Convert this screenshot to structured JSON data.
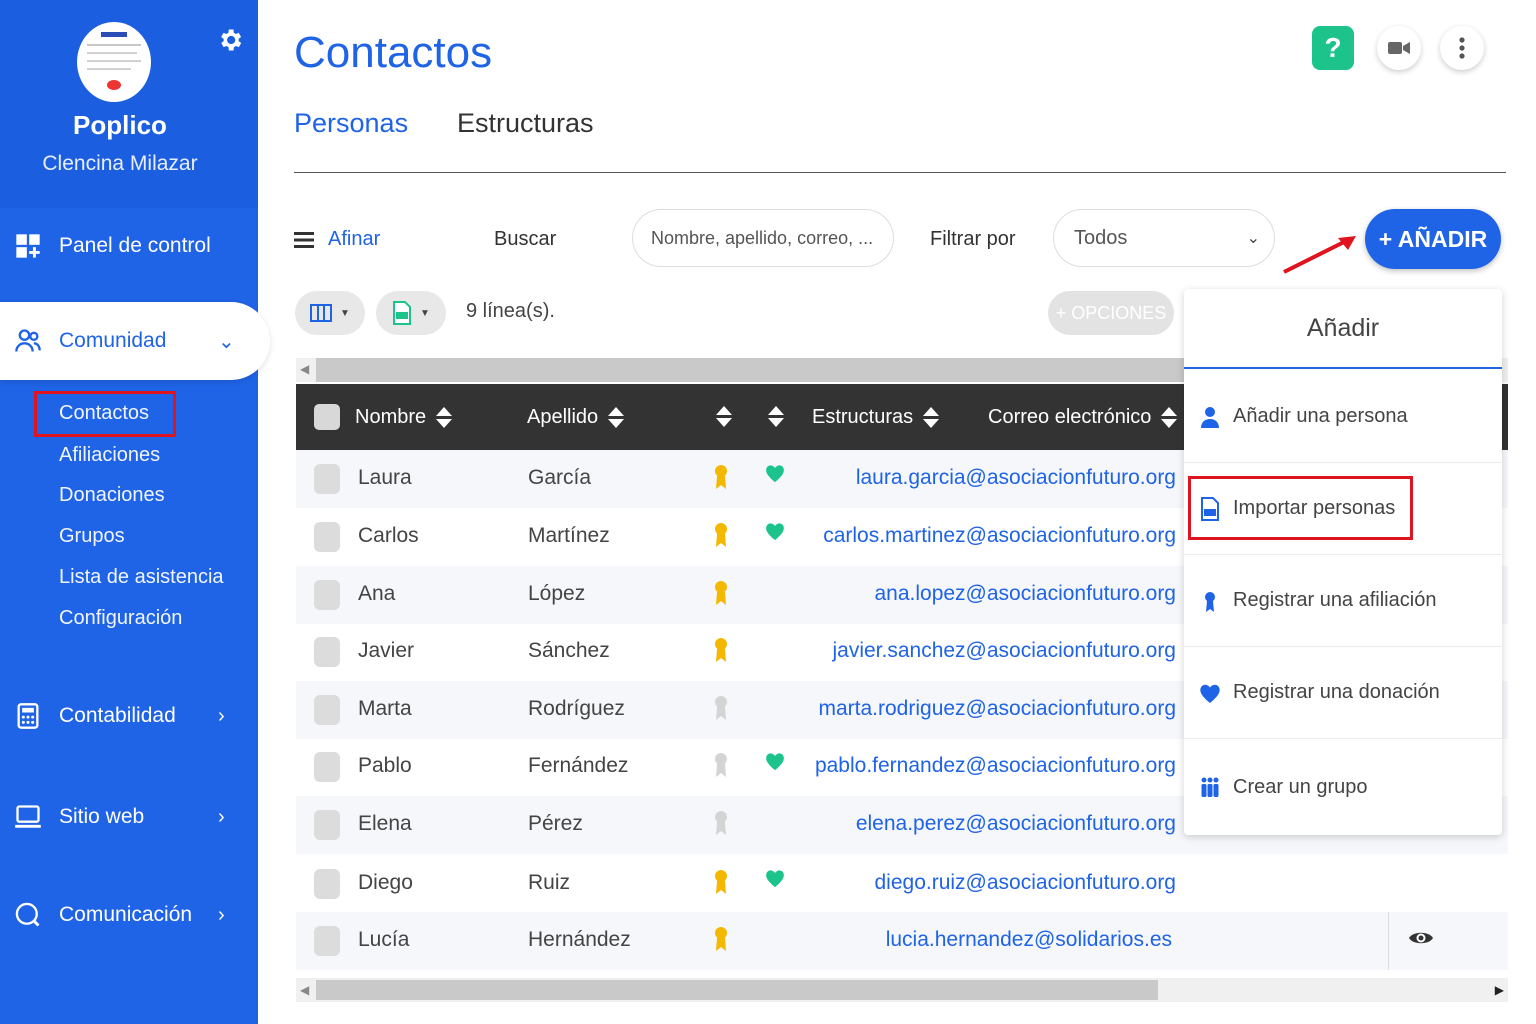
{
  "org": {
    "name": "Poplico",
    "user": "Clencina Milazar"
  },
  "sidebar": {
    "items": [
      {
        "label": "Panel de control",
        "icon": "dashboard-icon"
      },
      {
        "label": "Comunidad",
        "icon": "community-icon",
        "chevron": "⌄"
      },
      {
        "label": "Contabilidad",
        "icon": "calculator-icon",
        "chevron": "›"
      },
      {
        "label": "Sitio web",
        "icon": "monitor-icon",
        "chevron": "›"
      },
      {
        "label": "Comunicación",
        "icon": "chat-icon",
        "chevron": "›"
      }
    ],
    "sub_items": [
      "Contactos",
      "Afiliaciones",
      "Donaciones",
      "Grupos",
      "Lista de asistencia",
      "Configuración"
    ]
  },
  "header": {
    "title": "Contactos",
    "help": "?"
  },
  "tabs": [
    "Personas",
    "Estructuras"
  ],
  "toolbar": {
    "afinar": "Afinar",
    "buscar_label": "Buscar",
    "search_placeholder": "Nombre, apellido, correo, ...",
    "filtrar_label": "Filtrar por",
    "filter_value": "Todos",
    "add_button": "+ AÑADIR",
    "rows_count": "9 línea(s).",
    "options_button": "+ OPCIONES"
  },
  "table": {
    "headers": {
      "first": "Nombre",
      "last": "Apellido",
      "structures": "Estructuras",
      "email": "Correo electrónico"
    },
    "rows": [
      {
        "first": "Laura",
        "last": "García",
        "medal": "gold",
        "heart": true,
        "email": "laura.garcia@asociacionfuturo.org"
      },
      {
        "first": "Carlos",
        "last": "Martínez",
        "medal": "gold",
        "heart": true,
        "email": "carlos.martinez@asociacionfuturo.org"
      },
      {
        "first": "Ana",
        "last": "López",
        "medal": "gold",
        "heart": false,
        "email": "ana.lopez@asociacionfuturo.org"
      },
      {
        "first": "Javier",
        "last": "Sánchez",
        "medal": "gold",
        "heart": false,
        "email": "javier.sanchez@asociacionfuturo.org"
      },
      {
        "first": "Marta",
        "last": "Rodríguez",
        "medal": "gray",
        "heart": false,
        "email": "marta.rodriguez@asociacionfuturo.org"
      },
      {
        "first": "Pablo",
        "last": "Fernández",
        "medal": "gray",
        "heart": true,
        "email": "pablo.fernandez@asociacionfuturo.org"
      },
      {
        "first": "Elena",
        "last": "Pérez",
        "medal": "gray",
        "heart": false,
        "email": "elena.perez@asociacionfuturo.org"
      },
      {
        "first": "Diego",
        "last": "Ruiz",
        "medal": "gold",
        "heart": true,
        "email": "diego.ruiz@asociacionfuturo.org"
      },
      {
        "first": "Lucía",
        "last": "Hernández",
        "medal": "gold",
        "heart": false,
        "email": "lucia.hernandez@solidarios.es"
      }
    ]
  },
  "dropdown": {
    "title": "Añadir",
    "items": [
      {
        "label": "Añadir una persona",
        "icon": "person-icon"
      },
      {
        "label": "Importar personas",
        "icon": "csv-file-icon"
      },
      {
        "label": "Registrar una afiliación",
        "icon": "ribbon-icon"
      },
      {
        "label": "Registrar una donación",
        "icon": "heart-icon"
      },
      {
        "label": "Crear un grupo",
        "icon": "group-icon"
      }
    ]
  },
  "colors": {
    "primary": "#1f63e6",
    "teal": "#1cc38b",
    "highlight": "#e0141e",
    "gold": "#f5b800",
    "header_dark": "#333333"
  }
}
